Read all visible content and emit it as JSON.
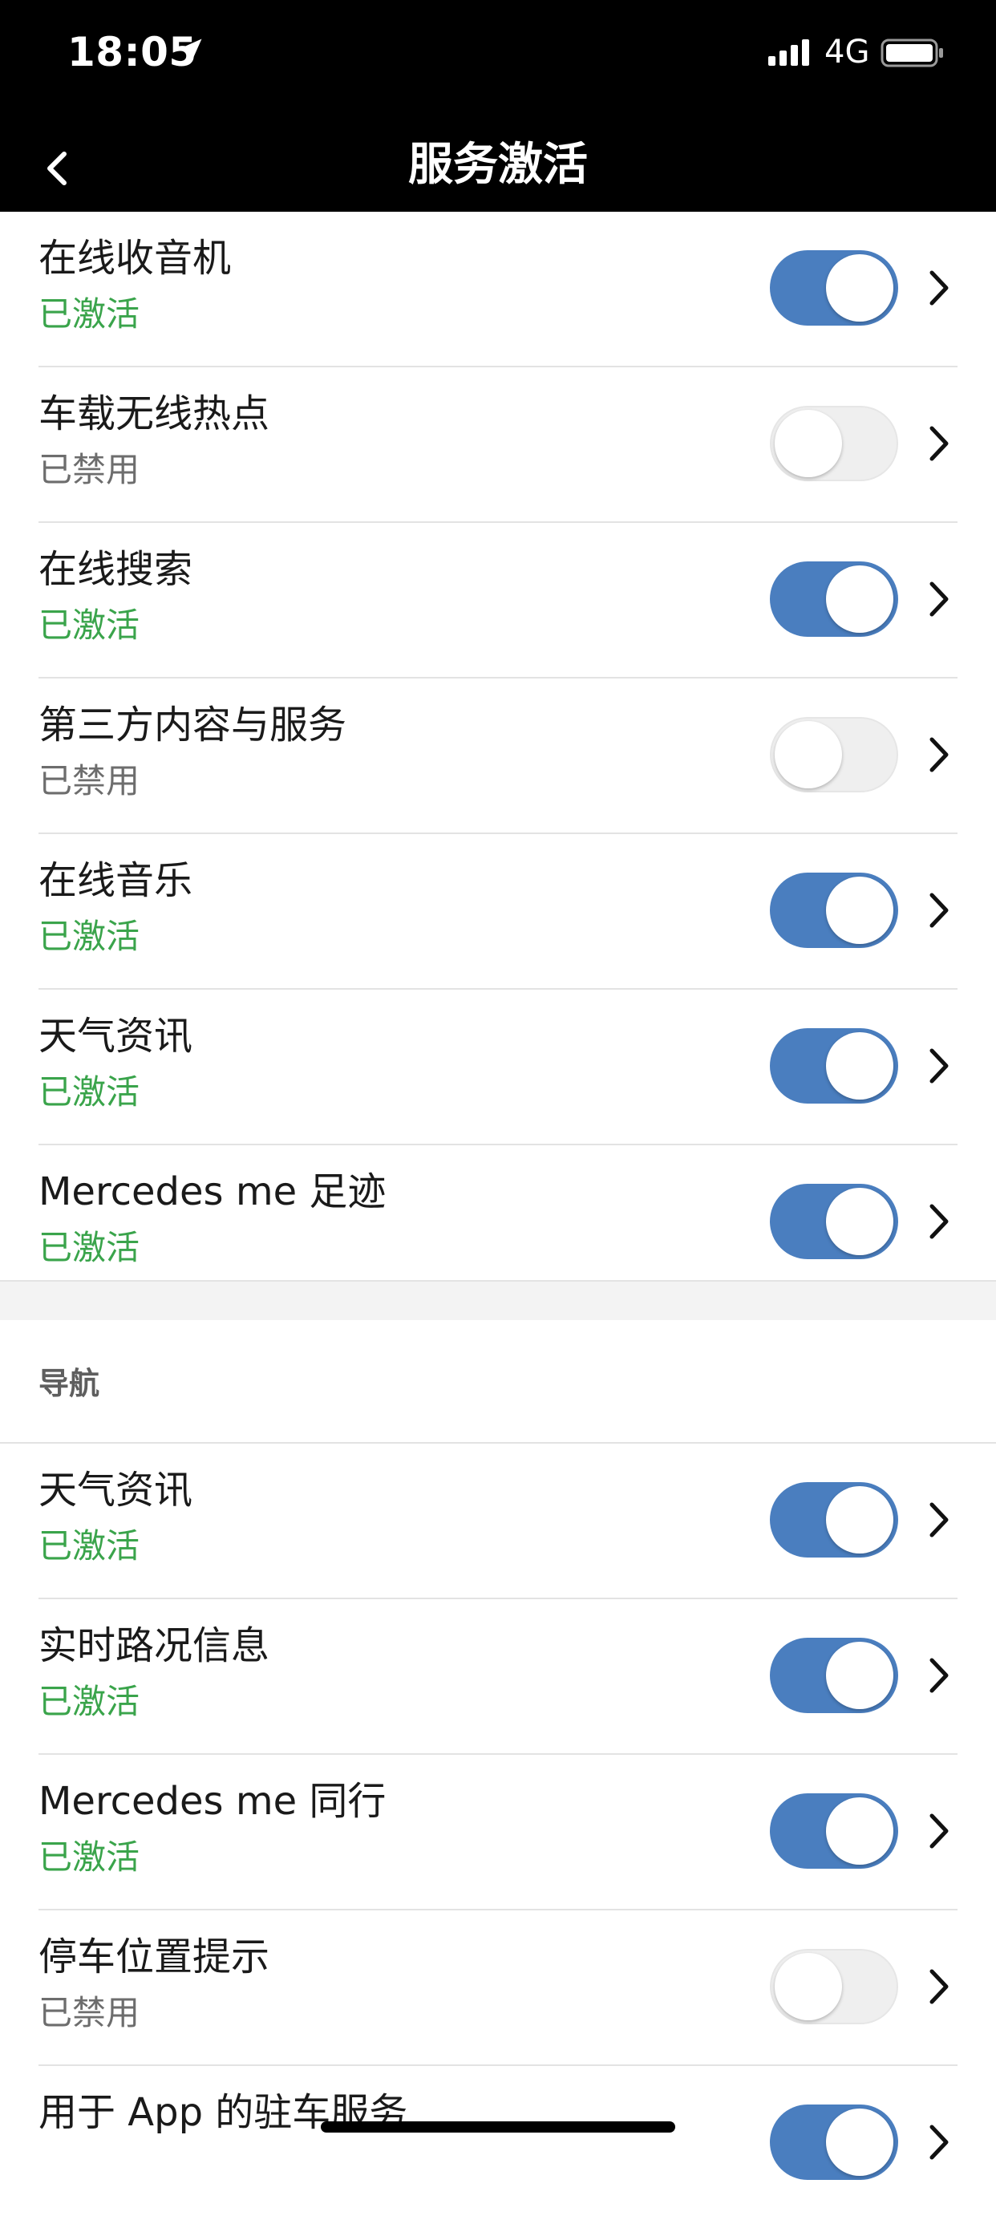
{
  "status_bar": {
    "time": "18:05",
    "network": "4G"
  },
  "header": {
    "title": "服务激活"
  },
  "entertainment_items": [
    {
      "title": "在线收音机",
      "status": "已激活",
      "enabled": true
    },
    {
      "title": "车载无线热点",
      "status": "已禁用",
      "enabled": false
    },
    {
      "title": "在线搜索",
      "status": "已激活",
      "enabled": true
    },
    {
      "title": "第三方内容与服务",
      "status": "已禁用",
      "enabled": false
    },
    {
      "title": "在线音乐",
      "status": "已激活",
      "enabled": true
    },
    {
      "title": "天气资讯",
      "status": "已激活",
      "enabled": true
    },
    {
      "title": "Mercedes me 足迹",
      "status": "已激活",
      "enabled": true
    }
  ],
  "navigation_section": {
    "label": "导航",
    "items": [
      {
        "title": "天气资讯",
        "status": "已激活",
        "enabled": true
      },
      {
        "title": "实时路况信息",
        "status": "已激活",
        "enabled": true
      },
      {
        "title": "Mercedes me 同行",
        "status": "已激活",
        "enabled": true
      },
      {
        "title": "停车位置提示",
        "status": "已禁用",
        "enabled": false
      },
      {
        "title": "用于 App 的驻车服务",
        "status": "",
        "enabled": true
      }
    ]
  },
  "colors": {
    "toggle_on": "#4a7ebf",
    "status_active": "#3aa44b",
    "status_disabled": "#6d6d6d"
  }
}
